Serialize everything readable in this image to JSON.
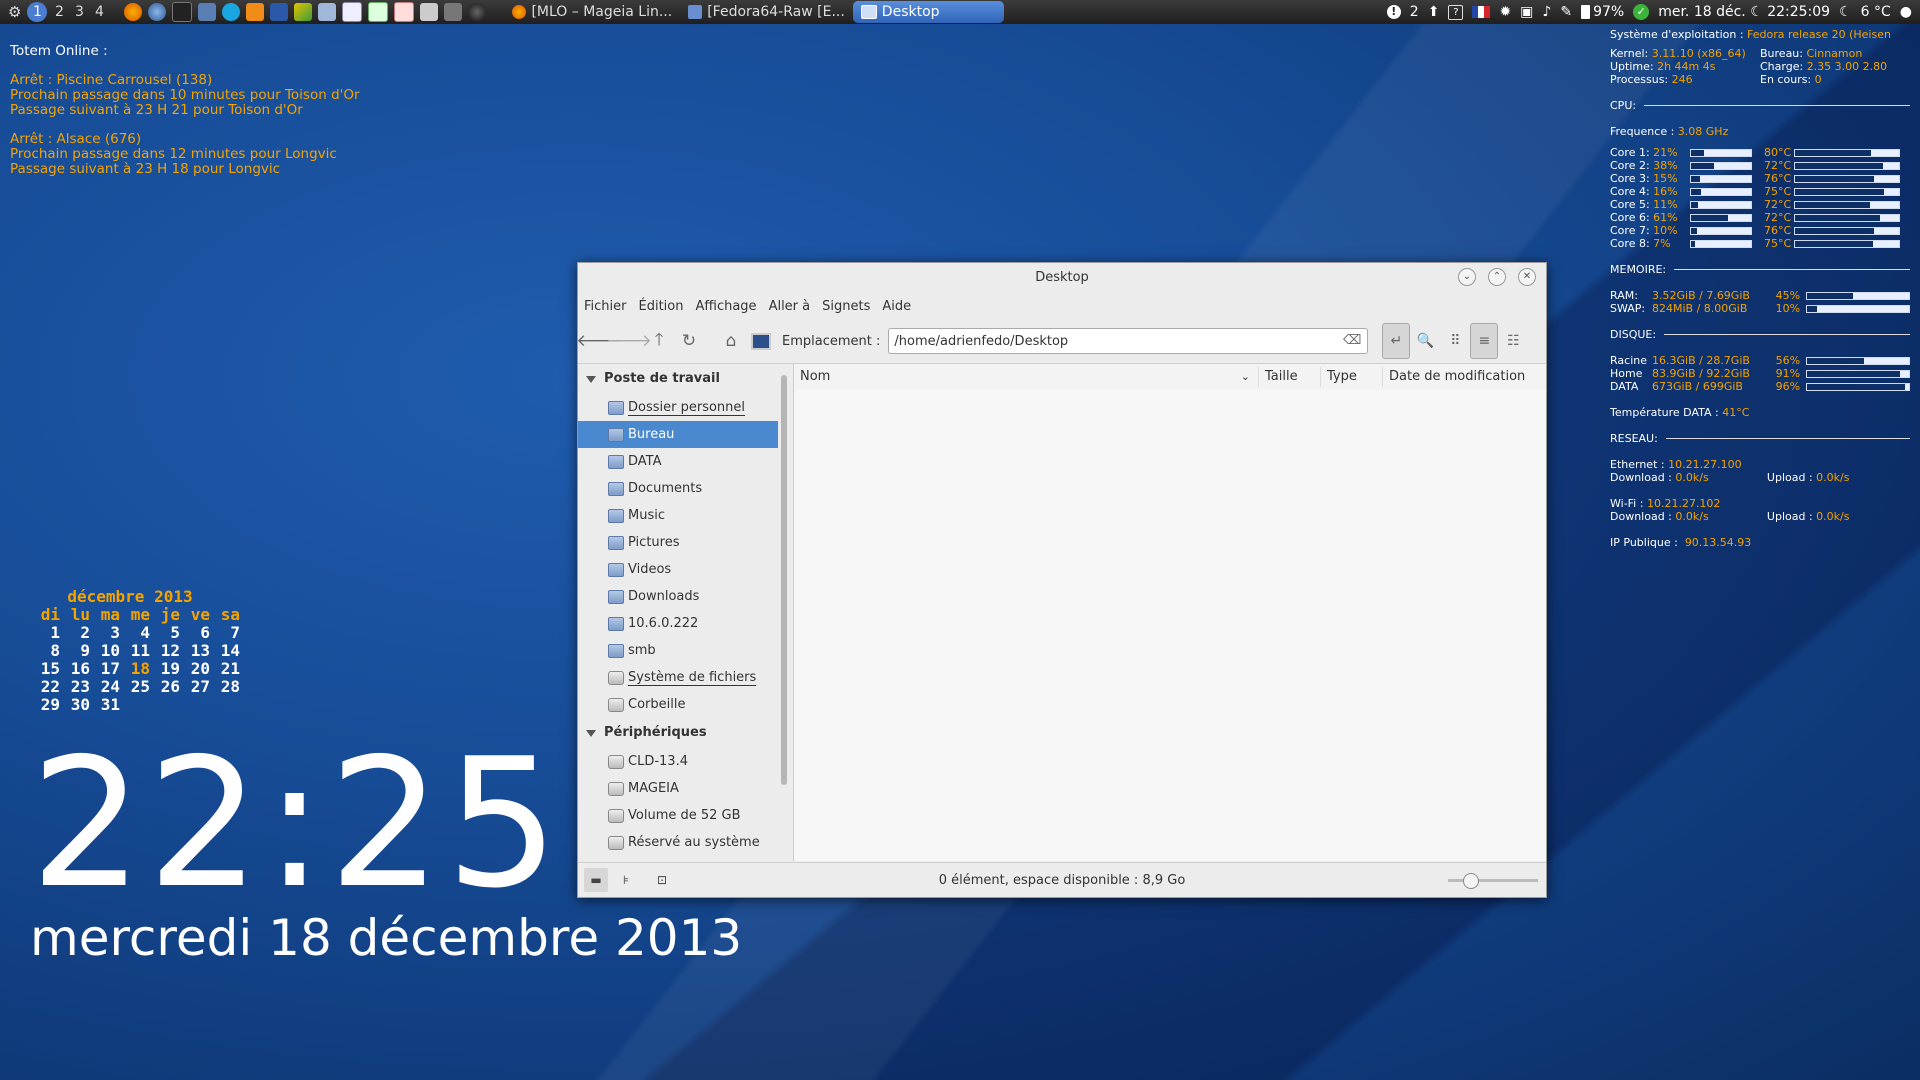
{
  "panel": {
    "workspaces": [
      "1",
      "2",
      "3",
      "4"
    ],
    "active_workspace": "1",
    "tasks": [
      {
        "label": "[MLO – Mageia Lin...",
        "icon": "firefox-icon"
      },
      {
        "label": "[Fedora64-Raw [E...",
        "icon": "virtualbox-icon"
      },
      {
        "label": "Desktop",
        "icon": "folder-icon",
        "active": true
      }
    ],
    "tray": {
      "notifications": "2",
      "battery": "97%",
      "datetime": "mer. 18 déc. ☾ 22:25:09",
      "weather": "6 °C"
    }
  },
  "totem": {
    "title": "Totem Online :",
    "stops": [
      {
        "line1": "Arrêt : Piscine Carrousel  (138)",
        "line2": "Prochain passage dans 10 minutes pour Toison d'Or",
        "line3": "Passage suivant à 23 H 21 pour Toison d'Or"
      },
      {
        "line1": "Arrêt : Alsace  (676)",
        "line2": "Prochain passage dans 12 minutes pour Longvic",
        "line3": "Passage suivant à 23 H 18 pour Longvic"
      }
    ]
  },
  "calendar": {
    "title": "décembre 2013",
    "days": [
      "di",
      "lu",
      "ma",
      "me",
      "je",
      "ve",
      "sa"
    ],
    "weeks": [
      [
        "1",
        "2",
        "3",
        "4",
        "5",
        "6",
        "7"
      ],
      [
        "8",
        "9",
        "10",
        "11",
        "12",
        "13",
        "14"
      ],
      [
        "15",
        "16",
        "17",
        "18",
        "19",
        "20",
        "21"
      ],
      [
        "22",
        "23",
        "24",
        "25",
        "26",
        "27",
        "28"
      ],
      [
        "29",
        "30",
        "31",
        "",
        "",
        "",
        ""
      ]
    ],
    "today": "18"
  },
  "clock": {
    "time": "22:25",
    "date": "mercredi 18 décembre 2013"
  },
  "sysinfo": {
    "os_label": "Système d'exploitation :",
    "os_value": "Fedora release 20 (Heisen",
    "kernel_label": "Kernel:",
    "kernel_value": "3.11.10 (x86_64)",
    "desktop_label": "Bureau:",
    "desktop_value": "Cinnamon",
    "uptime_label": "Uptime:",
    "uptime_value": "2h 44m 4s",
    "load_label": "Charge:",
    "load_value": "2.35 3.00 2.80",
    "proc_label": "Processus:",
    "proc_value": "246",
    "running_label": "En cours:",
    "running_value": "0",
    "cpu_header": "CPU:",
    "freq_label": "Frequence :",
    "freq_value": "3.08 GHz",
    "cores": [
      {
        "label": "Core 1:",
        "pct": "21%",
        "usage": 21,
        "temp": "80°C",
        "temp_fill": 73
      },
      {
        "label": "Core 2:",
        "pct": "38%",
        "usage": 38,
        "temp": "72°C",
        "temp_fill": 85
      },
      {
        "label": "Core 3:",
        "pct": "15%",
        "usage": 15,
        "temp": "76°C",
        "temp_fill": 76
      },
      {
        "label": "Core 4:",
        "pct": "16%",
        "usage": 16,
        "temp": "75°C",
        "temp_fill": 86
      },
      {
        "label": "Core 5:",
        "pct": "11%",
        "usage": 11,
        "temp": "72°C",
        "temp_fill": 72
      },
      {
        "label": "Core 6:",
        "pct": "61%",
        "usage": 61,
        "temp": "72°C",
        "temp_fill": 82
      },
      {
        "label": "Core 7:",
        "pct": "10%",
        "usage": 10,
        "temp": "76°C",
        "temp_fill": 76
      },
      {
        "label": "Core 8:",
        "pct": "7%",
        "usage": 7,
        "temp": "75°C",
        "temp_fill": 75
      }
    ],
    "mem_header": "MEMOIRE:",
    "mem": [
      {
        "label": "RAM:",
        "value": "3.52GiB / 7.69GiB",
        "pct": "45%",
        "fill": 45
      },
      {
        "label": "SWAP:",
        "value": "824MiB / 8.00GiB",
        "pct": "10%",
        "fill": 10
      }
    ],
    "disk_header": "DISQUE:",
    "disks": [
      {
        "label": "Racine",
        "value": "16.3GiB / 28.7GiB",
        "pct": "56%",
        "fill": 56
      },
      {
        "label": "Home",
        "value": "83.9GiB / 92.2GiB",
        "pct": "91%",
        "fill": 91
      },
      {
        "label": "DATA",
        "value": "673GiB / 699GiB",
        "pct": "96%",
        "fill": 96
      }
    ],
    "temp_label": "Température DATA :",
    "temp_value": "41°C",
    "net_header": "RESEAU:",
    "eth_label": "Ethernet :",
    "eth_value": "10.21.27.100",
    "eth_dl_label": "Download :",
    "eth_dl_value": "0.0k/s",
    "eth_ul_label": "Upload :",
    "eth_ul_value": "0.0k/s",
    "wifi_label": "Wi-Fi :",
    "wifi_value": "10.21.27.102",
    "wifi_dl_label": "Download :",
    "wifi_dl_value": "0.0k/s",
    "wifi_ul_label": "Upload :",
    "wifi_ul_value": "0.0k/s",
    "ip_label": "IP Publique :",
    "ip_value": "90.13.54.93"
  },
  "window": {
    "title": "Desktop",
    "menu": [
      "Fichier",
      "Édition",
      "Affichage",
      "Aller à",
      "Signets",
      "Aide"
    ],
    "location_label": "Emplacement :",
    "location_value": "/home/adrienfedo/Desktop",
    "sidebar": {
      "group1": "Poste de travail",
      "places": [
        "Dossier personnel",
        "Bureau",
        "DATA",
        "Documents",
        "Music",
        "Pictures",
        "Videos",
        "Downloads",
        "10.6.0.222",
        "smb",
        "Système de fichiers",
        "Corbeille"
      ],
      "selected": "Bureau",
      "group2": "Périphériques",
      "devices": [
        "CLD-13.4",
        "MAGEIA",
        "Volume de 52 GB",
        "Réservé au système"
      ]
    },
    "columns": {
      "name": "Nom",
      "size": "Taille",
      "type": "Type",
      "modified": "Date de modification"
    },
    "status": "0 élément, espace disponible : 8,9 Go"
  },
  "colors": {
    "accent": "#4a88d0",
    "conky_orange": "#f4a300",
    "desktop_blue": "#174c97"
  }
}
